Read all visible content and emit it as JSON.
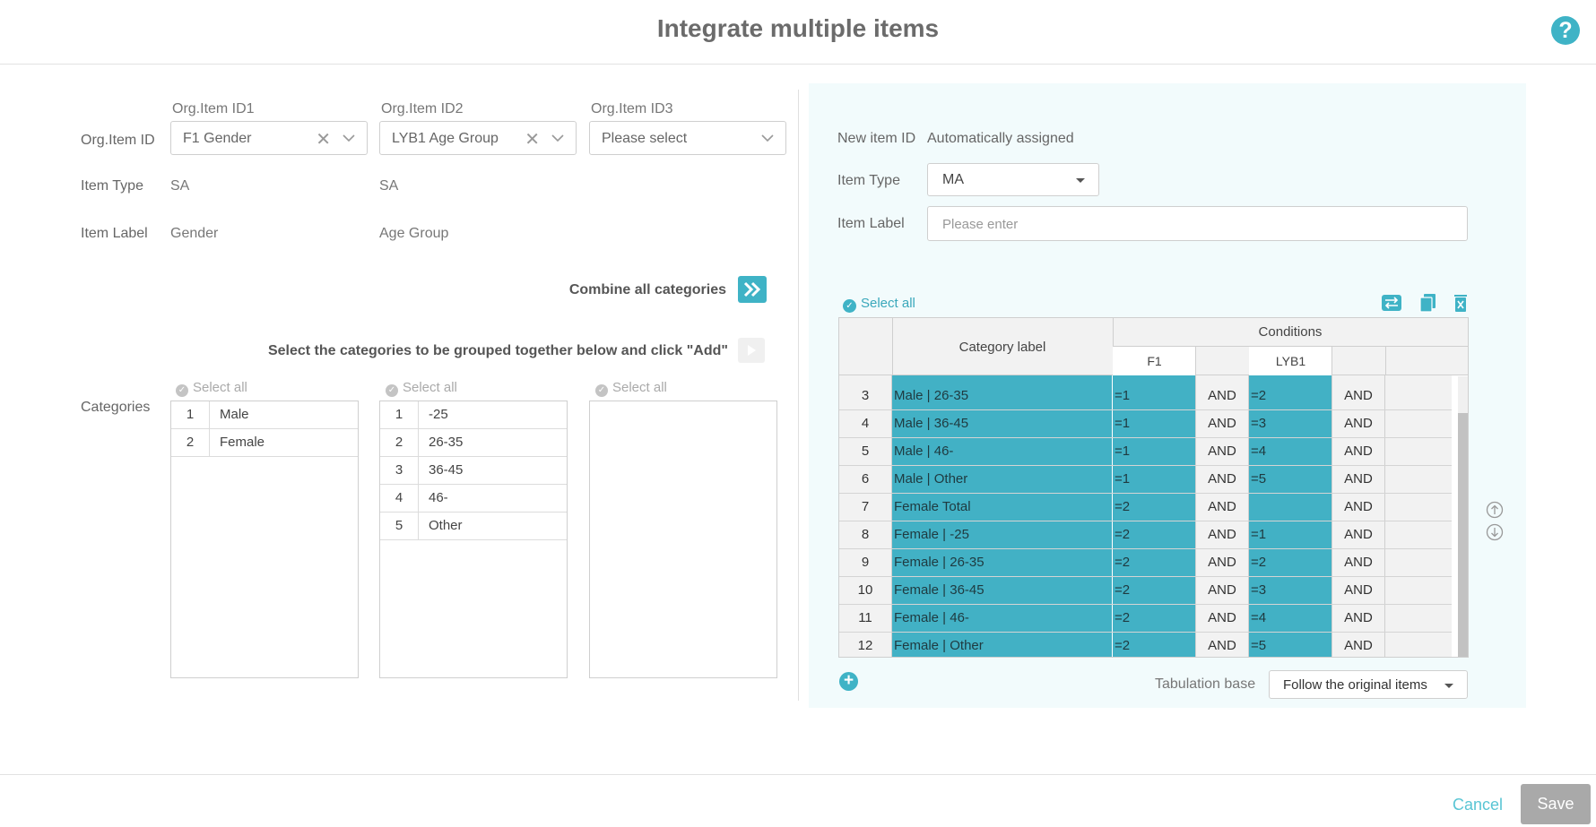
{
  "header": {
    "title": "Integrate multiple items",
    "help_icon": "question-circle-icon"
  },
  "left": {
    "org_item_id_label": "Org.Item ID",
    "item_type_label": "Item Type",
    "item_label_label": "Item Label",
    "categories_label": "Categories",
    "columns": [
      {
        "heading": "Org.Item ID1",
        "selected": "F1 Gender",
        "item_type": "SA",
        "item_label": "Gender"
      },
      {
        "heading": "Org.Item ID2",
        "selected": "LYB1 Age Group",
        "item_type": "SA",
        "item_label": "Age Group"
      },
      {
        "heading": "Org.Item ID3",
        "placeholder": "Please select"
      }
    ],
    "combine_label": "Combine all categories",
    "add_instruction": "Select the categories to be grouped together below and click \"Add\"",
    "select_all": "Select all",
    "cat_lists": [
      [
        {
          "num": "1",
          "label": "Male"
        },
        {
          "num": "2",
          "label": "Female"
        }
      ],
      [
        {
          "num": "1",
          "label": "-25"
        },
        {
          "num": "2",
          "label": "26-35"
        },
        {
          "num": "3",
          "label": "36-45"
        },
        {
          "num": "4",
          "label": "46-"
        },
        {
          "num": "5",
          "label": "Other"
        }
      ],
      []
    ]
  },
  "right": {
    "new_item_id_label": "New item ID",
    "new_item_id_value": "Automatically assigned",
    "item_type_label": "Item Type",
    "item_type_value": "MA",
    "item_label_label": "Item Label",
    "item_label_placeholder": "Please enter",
    "select_all": "Select all",
    "table": {
      "category_header": "Category label",
      "conditions_header": "Conditions",
      "cond_cols": [
        "F1",
        "LYB1"
      ],
      "rows": [
        {
          "num": "3",
          "label": "Male | 26-35",
          "f1": "=1",
          "and1": "AND",
          "lyb1": "=2",
          "and2": "AND"
        },
        {
          "num": "4",
          "label": "Male | 36-45",
          "f1": "=1",
          "and1": "AND",
          "lyb1": "=3",
          "and2": "AND"
        },
        {
          "num": "5",
          "label": "Male | 46-",
          "f1": "=1",
          "and1": "AND",
          "lyb1": "=4",
          "and2": "AND"
        },
        {
          "num": "6",
          "label": "Male | Other",
          "f1": "=1",
          "and1": "AND",
          "lyb1": "=5",
          "and2": "AND"
        },
        {
          "num": "7",
          "label": "Female Total",
          "f1": "=2",
          "and1": "AND",
          "lyb1": "",
          "and2": "AND"
        },
        {
          "num": "8",
          "label": "Female | -25",
          "f1": "=2",
          "and1": "AND",
          "lyb1": "=1",
          "and2": "AND"
        },
        {
          "num": "9",
          "label": "Female | 26-35",
          "f1": "=2",
          "and1": "AND",
          "lyb1": "=2",
          "and2": "AND"
        },
        {
          "num": "10",
          "label": "Female | 36-45",
          "f1": "=2",
          "and1": "AND",
          "lyb1": "=3",
          "and2": "AND"
        },
        {
          "num": "11",
          "label": "Female | 46-",
          "f1": "=2",
          "and1": "AND",
          "lyb1": "=4",
          "and2": "AND"
        },
        {
          "num": "12",
          "label": "Female | Other",
          "f1": "=2",
          "and1": "AND",
          "lyb1": "=5",
          "and2": "AND"
        }
      ]
    },
    "tabulation_base_label": "Tabulation base",
    "tabulation_base_value": "Follow the original items"
  },
  "footer": {
    "cancel": "Cancel",
    "save": "Save"
  },
  "colors": {
    "accent": "#3fb3c6",
    "cell_selected": "#42b1c5",
    "panel_bg": "#f2fbfc"
  }
}
